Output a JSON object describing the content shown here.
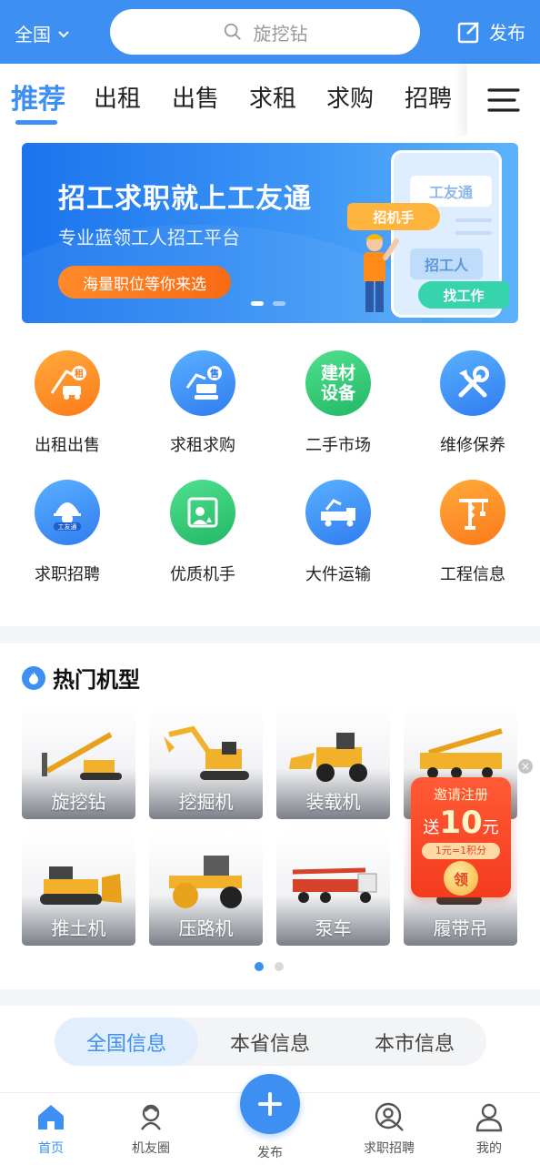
{
  "header": {
    "region": "全国",
    "search_placeholder": "旋挖钻",
    "publish_label": "发布"
  },
  "tabs": [
    {
      "label": "推荐",
      "active": true
    },
    {
      "label": "出租"
    },
    {
      "label": "出售"
    },
    {
      "label": "求租"
    },
    {
      "label": "求购"
    },
    {
      "label": "招聘"
    }
  ],
  "banner": {
    "title": "招工求职就上工友通",
    "subtitle": "专业蓝领工人招工平台",
    "button": "海量职位等你来选",
    "phone_title": "工友通",
    "tag_operator": "招机手",
    "tag_recruit": "招工人",
    "tag_find_job": "找工作"
  },
  "categories": [
    {
      "label": "出租出售",
      "icon": "rental-sale-icon",
      "badge": "租"
    },
    {
      "label": "求租求购",
      "icon": "want-rent-icon",
      "badge": "售"
    },
    {
      "label": "二手市场",
      "icon": "used-market-icon",
      "icon_text": "建材设备"
    },
    {
      "label": "维修保养",
      "icon": "repair-icon"
    },
    {
      "label": "求职招聘",
      "icon": "job-icon",
      "icon_text": "工友通"
    },
    {
      "label": "优质机手",
      "icon": "operator-icon"
    },
    {
      "label": "大件运输",
      "icon": "transport-icon"
    },
    {
      "label": "工程信息",
      "icon": "crane-icon"
    }
  ],
  "hot": {
    "title": "热门机型",
    "items": [
      {
        "label": "旋挖钻"
      },
      {
        "label": "挖掘机"
      },
      {
        "label": "装载机"
      },
      {
        "label": ""
      },
      {
        "label": "推土机"
      },
      {
        "label": "压路机"
      },
      {
        "label": "泵车"
      },
      {
        "label": "履带吊"
      }
    ]
  },
  "promo": {
    "line1": "邀请注册",
    "line2_pre": "送",
    "amount": "10",
    "line2_post": "元",
    "line3": "1元=1积分",
    "button": "领",
    "close": "×"
  },
  "info_tabs": [
    {
      "label": "全国信息",
      "active": true
    },
    {
      "label": "本省信息"
    },
    {
      "label": "本市信息"
    }
  ],
  "bottom_nav": [
    {
      "label": "首页",
      "active": true
    },
    {
      "label": "机友圈"
    },
    {
      "label": "发布"
    },
    {
      "label": "求职招聘"
    },
    {
      "label": "我的"
    }
  ],
  "colors": {
    "primary": "#3d8ff2",
    "orange": "#fb7a1b",
    "green": "#22b865",
    "promo_red": "#f43b1e"
  }
}
